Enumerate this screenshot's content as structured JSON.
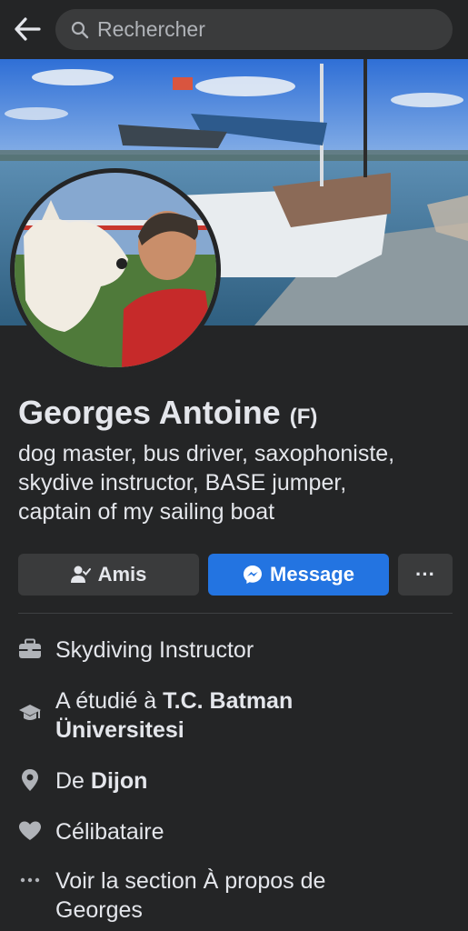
{
  "header": {
    "search_placeholder": "Rechercher"
  },
  "profile": {
    "name": "Georges Antoine",
    "name_suffix": "(F)",
    "bio_lines": [
      "dog master, bus driver, saxophoniste,",
      "skydive instructor, BASE jumper,",
      "captain of my sailing boat"
    ]
  },
  "actions": {
    "friends_label": "Amis",
    "message_label": "Message",
    "more_label": "···"
  },
  "about": {
    "work": "Skydiving Instructor",
    "education_prefix": "A étudié à ",
    "education_school_line1": "T.C. Batman",
    "education_school_line2": "Üniversitesi",
    "hometown_prefix": "De ",
    "hometown": "Dijon",
    "relationship": "Célibataire",
    "see_about_line1": "Voir la section À propos de",
    "see_about_line2": "Georges"
  },
  "colors": {
    "background": "#242526",
    "surface": "#3a3b3c",
    "accent": "#2374e1",
    "text": "#e4e6eb",
    "muted": "#b0b3b8"
  },
  "icons": {
    "back": "arrow-left-icon",
    "search": "search-icon",
    "friends": "person-check-icon",
    "message": "messenger-icon",
    "more": "ellipsis-icon",
    "work": "briefcase-icon",
    "education": "graduation-cap-icon",
    "hometown": "location-pin-icon",
    "relationship": "heart-icon",
    "see_about": "ellipsis-icon"
  }
}
